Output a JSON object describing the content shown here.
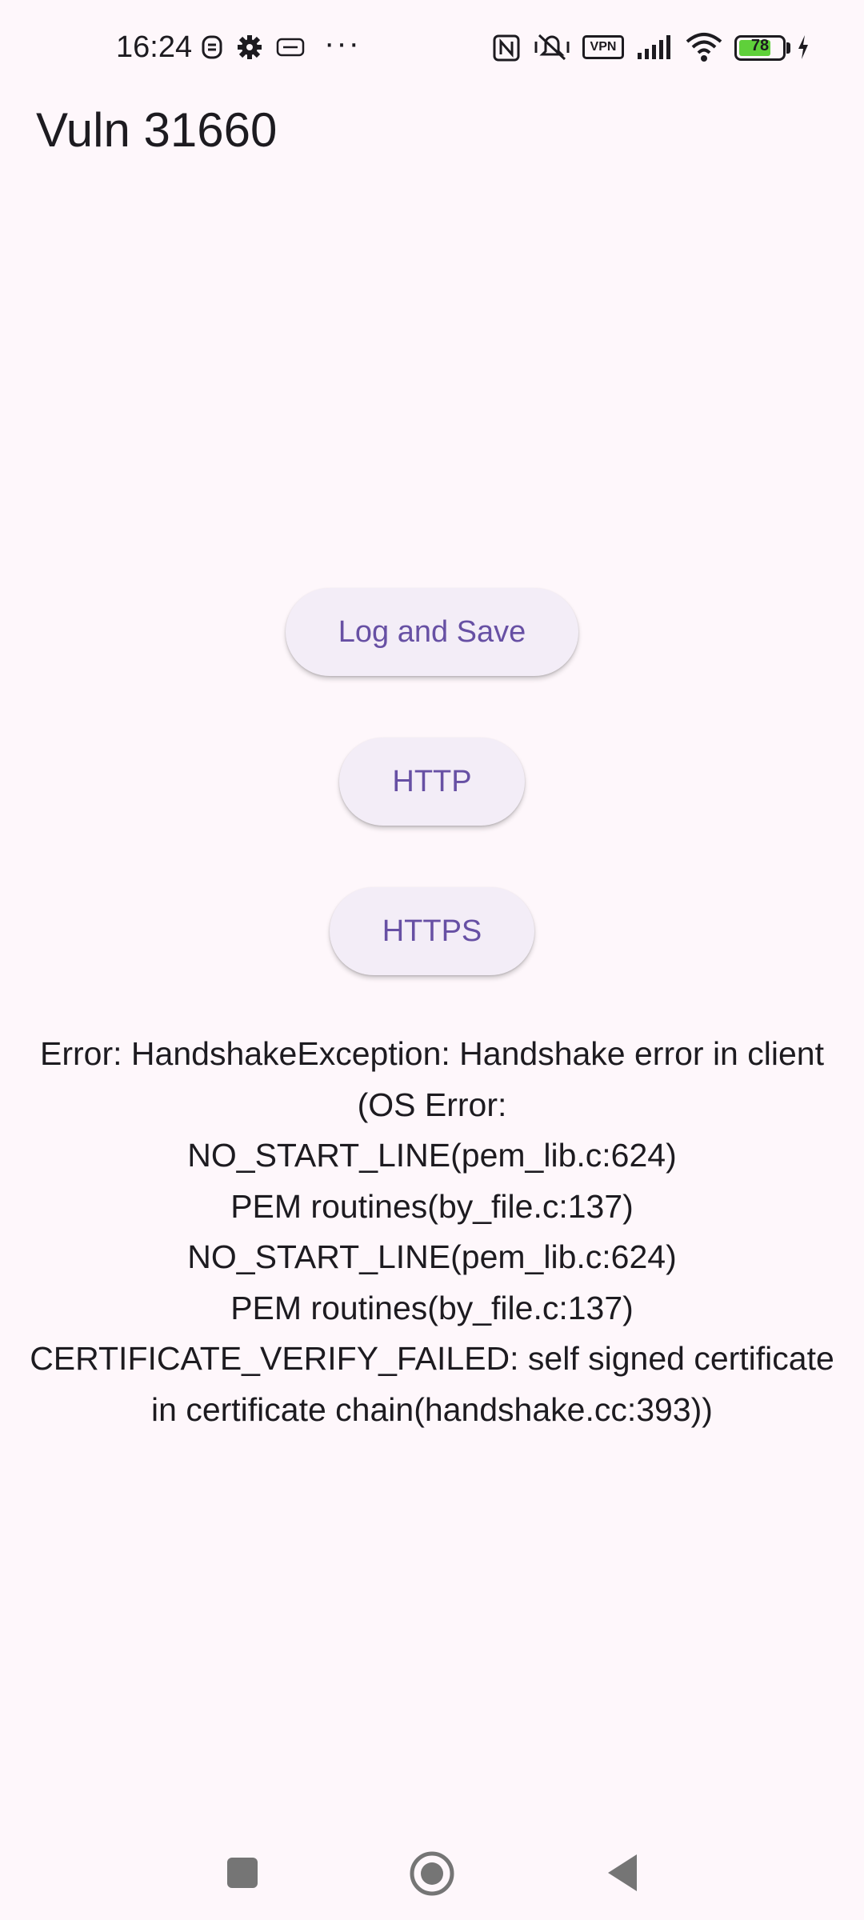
{
  "status_bar": {
    "time": "16:24",
    "battery_level": "78",
    "battery_fraction": 0.78,
    "icons": [
      "bluetooth-face-icon",
      "gear-icon",
      "media-icon",
      "more-dots-icon",
      "nfc-icon",
      "mute-icon",
      "vpn-icon",
      "signal-icon",
      "wifi-icon",
      "battery-icon",
      "charging-icon"
    ],
    "vpn_label": "VPN",
    "more_label": "···"
  },
  "app_bar": {
    "title": "Vuln 31660"
  },
  "buttons": {
    "log_and_save": "Log and Save",
    "http": "HTTP",
    "https": "HTTPS"
  },
  "error": {
    "lines": [
      "Error: HandshakeException: Handshake error in client",
      "(OS Error:",
      "NO_START_LINE(pem_lib.c:624)",
      "PEM routines(by_file.c:137)",
      "NO_START_LINE(pem_lib.c:624)",
      "PEM routines(by_file.c:137)",
      "CERTIFICATE_VERIFY_FAILED: self signed certificate",
      "in certificate chain(handshake.cc:393))"
    ]
  },
  "colors": {
    "background": "#fef7fb",
    "button_bg": "#f3edf7",
    "accent": "#6750a4",
    "battery": "#5fd03a"
  },
  "nav_bar": {
    "icons": [
      "recents-square-icon",
      "home-circle-icon",
      "back-triangle-icon"
    ]
  }
}
